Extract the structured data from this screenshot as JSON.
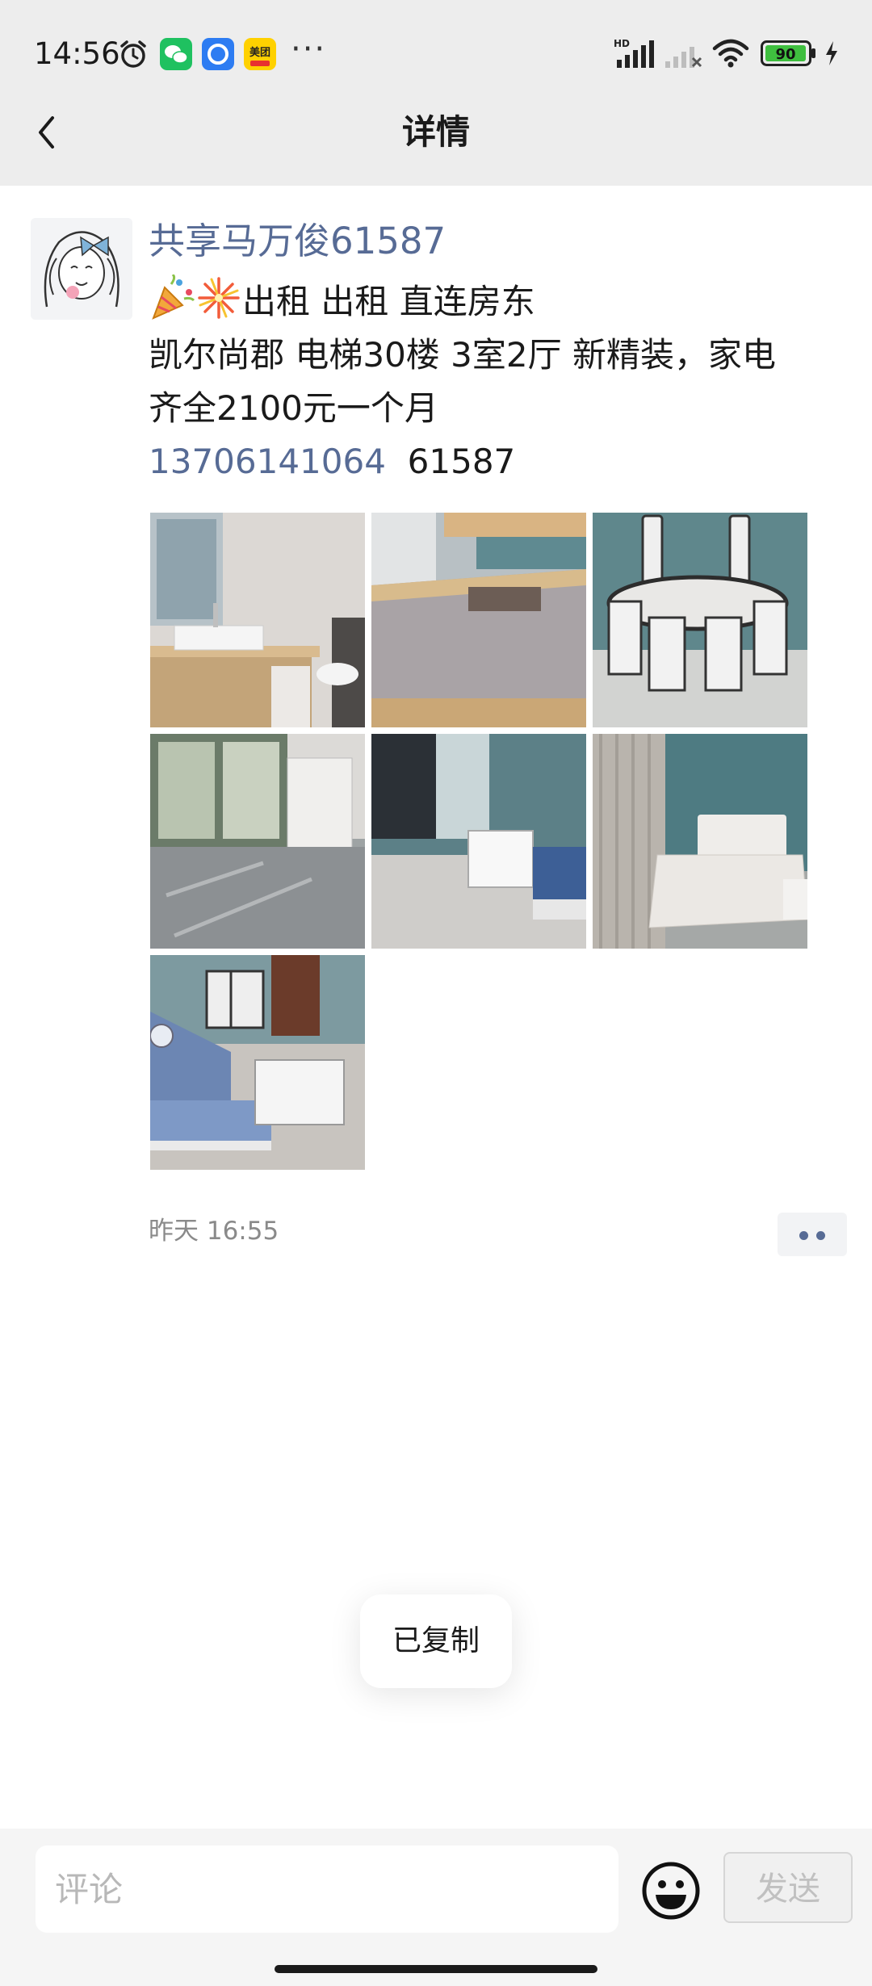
{
  "status_bar": {
    "time": "14:56",
    "battery": "90",
    "network_label": "HD",
    "overflow": "···",
    "app_badge": "美团"
  },
  "header": {
    "title": "详情"
  },
  "post": {
    "author": "共享马万俊61587",
    "lines": [
      "出租 出租 直连房东",
      "凯尔尚郡 电梯30楼 3室2厅 新精装，家电",
      "齐全2100元一个月"
    ],
    "phone": "13706141064",
    "code": "61587",
    "photos": [
      "bathroom-sink-photo",
      "mattress-photo",
      "dining-table-photo",
      "balcony-cabinet-photo",
      "living-room-photo",
      "bed-frame-photo",
      "sofa-dining-photo"
    ],
    "timestamp": "昨天 16:55"
  },
  "toast": {
    "text": "已复制"
  },
  "comment_bar": {
    "placeholder": "评论",
    "send_label": "发送"
  },
  "colors": {
    "link": "#576b95",
    "header_bg": "#ededed",
    "bottom_bg": "#f5f5f5"
  }
}
